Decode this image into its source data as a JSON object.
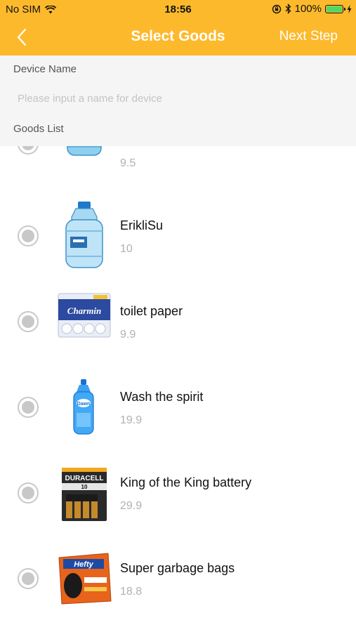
{
  "status_bar": {
    "carrier": "No SIM",
    "time": "18:56",
    "battery": "100%",
    "battery_level": 1.0,
    "icons": [
      "wifi-icon",
      "orientation-lock-icon",
      "bluetooth-icon",
      "battery-icon",
      "charging-icon"
    ]
  },
  "nav": {
    "title": "Select Goods",
    "next_label": "Next Step",
    "back_icon": "chevron-left-icon"
  },
  "form": {
    "device_name_label": "Device Name",
    "device_name_value": "",
    "device_name_placeholder": "Please input a name for device",
    "goods_list_label": "Goods List"
  },
  "goods": [
    {
      "name": "",
      "price": "9.5",
      "image": "water-bottle-small",
      "selected": false
    },
    {
      "name": "ErikliSu",
      "price": "10",
      "image": "water-jug",
      "selected": false
    },
    {
      "name": "toilet paper",
      "price": "9.9",
      "image": "toilet-paper-pack",
      "selected": false
    },
    {
      "name": "Wash the spirit",
      "price": "19.9",
      "image": "dish-soap-bottle",
      "selected": false
    },
    {
      "name": "King of the King battery",
      "price": "29.9",
      "image": "battery-pack",
      "selected": false
    },
    {
      "name": "Super garbage bags",
      "price": "18.8",
      "image": "garbage-bags-box",
      "selected": false
    }
  ],
  "colors": {
    "accent": "#fdb92c",
    "header_bg": "#f5f5f5",
    "price": "#b1b1b1",
    "radio": "#c8c8c8"
  }
}
